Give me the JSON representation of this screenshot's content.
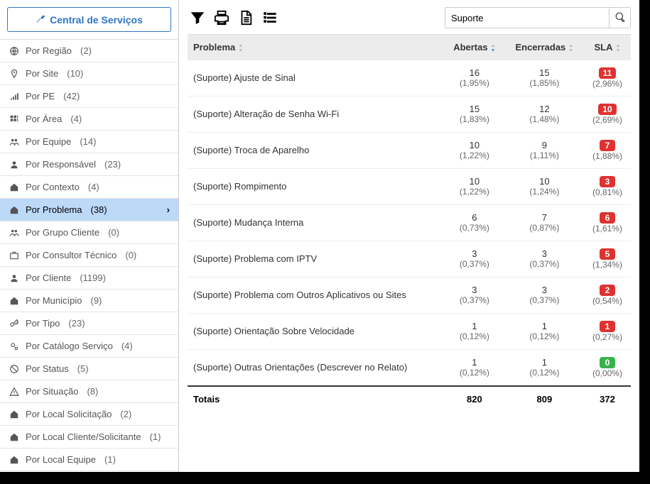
{
  "sidebar": {
    "header": "Central de Serviços",
    "items": [
      {
        "icon": "globe",
        "label": "Por Região",
        "count": "(2)",
        "active": false
      },
      {
        "icon": "pin",
        "label": "Por Site",
        "count": "(10)",
        "active": false
      },
      {
        "icon": "signal",
        "label": "Por PE",
        "count": "(42)",
        "active": false
      },
      {
        "icon": "grid",
        "label": "Por Área",
        "count": "(4)",
        "active": false
      },
      {
        "icon": "users",
        "label": "Por Equipe",
        "count": "(14)",
        "active": false
      },
      {
        "icon": "user",
        "label": "Por Responsável",
        "count": "(23)",
        "active": false
      },
      {
        "icon": "home",
        "label": "Por Contexto",
        "count": "(4)",
        "active": false
      },
      {
        "icon": "home",
        "label": "Por Problema",
        "count": "(38)",
        "active": true
      },
      {
        "icon": "users",
        "label": "Por Grupo Cliente",
        "count": "(0)",
        "active": false
      },
      {
        "icon": "briefcase",
        "label": "Por Consultor Técnico",
        "count": "(0)",
        "active": false
      },
      {
        "icon": "user",
        "label": "Por Cliente",
        "count": "(1199)",
        "active": false
      },
      {
        "icon": "home",
        "label": "Por Município",
        "count": "(9)",
        "active": false
      },
      {
        "icon": "key",
        "label": "Por Tipo",
        "count": "(23)",
        "active": false
      },
      {
        "icon": "gears",
        "label": "Por Catálogo Serviço",
        "count": "(4)",
        "active": false
      },
      {
        "icon": "block",
        "label": "Por Status",
        "count": "(5)",
        "active": false
      },
      {
        "icon": "warn",
        "label": "Por Situação",
        "count": "(8)",
        "active": false
      },
      {
        "icon": "home",
        "label": "Por Local Solicitação",
        "count": "(2)",
        "active": false
      },
      {
        "icon": "home",
        "label": "Por Local Cliente/Solicitante",
        "count": "(1)",
        "active": false
      },
      {
        "icon": "home",
        "label": "Por Local Equipe",
        "count": "(1)",
        "active": false
      }
    ]
  },
  "toolbar": {
    "search_value": "Suporte"
  },
  "table": {
    "headers": {
      "problema": "Problema",
      "abertas": "Abertas",
      "encerradas": "Encerradas",
      "sla": "SLA"
    },
    "rows": [
      {
        "problema": "(Suporte) Ajuste de Sinal",
        "abertas": "16",
        "abertas_pct": "(1,95%)",
        "encerradas": "15",
        "encerradas_pct": "(1,85%)",
        "sla": "11",
        "sla_pct": "(2,96%)",
        "sla_color": "red"
      },
      {
        "problema": "(Suporte) Alteração de Senha Wi-Fi",
        "abertas": "15",
        "abertas_pct": "(1,83%)",
        "encerradas": "12",
        "encerradas_pct": "(1,48%)",
        "sla": "10",
        "sla_pct": "(2,69%)",
        "sla_color": "red"
      },
      {
        "problema": "(Suporte) Troca de Aparelho",
        "abertas": "10",
        "abertas_pct": "(1,22%)",
        "encerradas": "9",
        "encerradas_pct": "(1,11%)",
        "sla": "7",
        "sla_pct": "(1,88%)",
        "sla_color": "red"
      },
      {
        "problema": "(Suporte) Rompimento",
        "abertas": "10",
        "abertas_pct": "(1,22%)",
        "encerradas": "10",
        "encerradas_pct": "(1,24%)",
        "sla": "3",
        "sla_pct": "(0,81%)",
        "sla_color": "red"
      },
      {
        "problema": "(Suporte) Mudança Interna",
        "abertas": "6",
        "abertas_pct": "(0,73%)",
        "encerradas": "7",
        "encerradas_pct": "(0,87%)",
        "sla": "6",
        "sla_pct": "(1,61%)",
        "sla_color": "red"
      },
      {
        "problema": "(Suporte) Problema com IPTV",
        "abertas": "3",
        "abertas_pct": "(0,37%)",
        "encerradas": "3",
        "encerradas_pct": "(0,37%)",
        "sla": "5",
        "sla_pct": "(1,34%)",
        "sla_color": "red"
      },
      {
        "problema": "(Suporte) Problema com Outros Aplicativos ou Sites",
        "abertas": "3",
        "abertas_pct": "(0,37%)",
        "encerradas": "3",
        "encerradas_pct": "(0,37%)",
        "sla": "2",
        "sla_pct": "(0,54%)",
        "sla_color": "red"
      },
      {
        "problema": "(Suporte) Orientação Sobre Velocidade",
        "abertas": "1",
        "abertas_pct": "(0,12%)",
        "encerradas": "1",
        "encerradas_pct": "(0,12%)",
        "sla": "1",
        "sla_pct": "(0,27%)",
        "sla_color": "red"
      },
      {
        "problema": "(Suporte) Outras Orientações (Descrever no Relato)",
        "abertas": "1",
        "abertas_pct": "(0,12%)",
        "encerradas": "1",
        "encerradas_pct": "(0,12%)",
        "sla": "0",
        "sla_pct": "(0,00%)",
        "sla_color": "green"
      }
    ],
    "footer": {
      "label": "Totais",
      "abertas": "820",
      "encerradas": "809",
      "sla": "372"
    }
  }
}
